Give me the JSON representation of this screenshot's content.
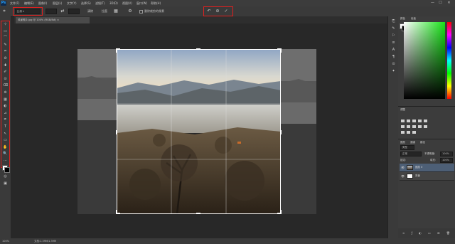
{
  "app": {
    "logo": "Ps"
  },
  "menu": {
    "items": [
      "文件(F)",
      "编辑(E)",
      "图像(I)",
      "图层(L)",
      "文字(Y)",
      "选择(S)",
      "滤镜(T)",
      "3D(D)",
      "视图(V)",
      "窗口(W)",
      "帮助(H)"
    ],
    "window_buttons": [
      "—",
      "☐",
      "✕"
    ]
  },
  "options": {
    "ratio_select": "比例 ▾",
    "ratio_w": "",
    "ratio_h": "",
    "clear_label": "清除",
    "straighten_label": "拉直",
    "delete_pixels_label": "删除裁剪的像素",
    "reset_icon": "↶",
    "cancel_icon": "⊘",
    "commit_icon": "✓"
  },
  "document": {
    "tab_title": "风景照片.jpg @ 100% (RGB/8#) ×"
  },
  "status": {
    "zoom": "100%",
    "doc_size": "文档:1.39M/1.39M"
  },
  "tools": [
    "⊹",
    "▭",
    "⌒",
    "✎",
    "⌗",
    "⊘",
    "✚",
    "✐",
    "⊙",
    "⌫",
    "⊚",
    "▦",
    "◐",
    "⊿",
    "✒",
    "T",
    "↖",
    "▭",
    "✋",
    "🔍",
    "⋯"
  ],
  "dock_icons": [
    "⎘",
    "✎",
    "⚐",
    "≡",
    "A",
    "¶",
    "⊙",
    "✦"
  ],
  "panels": {
    "tabs_top": [
      "颜色",
      "色板"
    ],
    "adjustments_tab": "调整",
    "layers_tabs": [
      "图层",
      "通道",
      "路径"
    ],
    "filter_label": "类型",
    "blend_mode": "正常",
    "opacity_label": "不透明度:",
    "opacity_value": "100%",
    "lock_label": "锁定:",
    "fill_label": "填充:",
    "fill_value": "100%",
    "layers": [
      {
        "name": "图层 0",
        "thumb": "photo"
      },
      {
        "name": "背景",
        "thumb": "white"
      }
    ]
  },
  "colors": {
    "accent_red": "#e0201f",
    "app_bg": "#282828",
    "panel_bg": "#3c3c3c"
  }
}
